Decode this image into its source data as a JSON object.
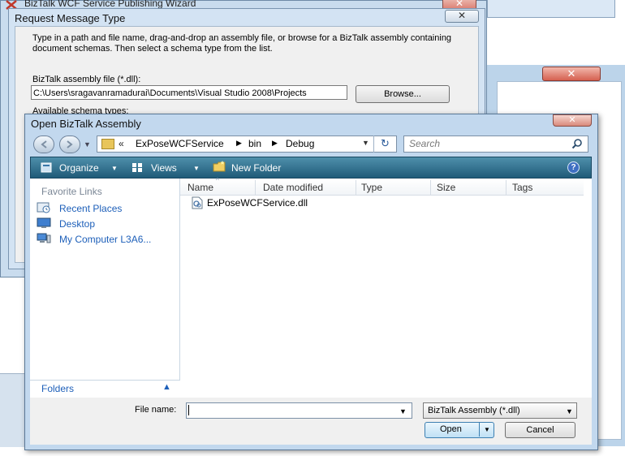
{
  "wizard": {
    "title": "BizTalk WCF Service Publishing Wizard",
    "close_glyph": "✕"
  },
  "background_window": {
    "close_glyph": "✕"
  },
  "request_dialog": {
    "title": "Request Message Type",
    "close_glyph": "✕",
    "description": "Type in a path and file name, drag-and-drop an assembly file, or browse for a BizTalk assembly containing document schemas. Then select a schema type from the list.",
    "assembly_label": "BizTalk assembly file (*.dll):",
    "assembly_path": "C:\\Users\\sragavanramadurai\\Documents\\Visual Studio 2008\\Projects",
    "browse_label": "Browse...",
    "schema_types_label": "Available schema types:"
  },
  "open_dialog": {
    "title": "Open BizTalk Assembly",
    "close_glyph": "✕",
    "address": {
      "overflow_glyph": "«",
      "crumbs": [
        "ExPoseWCFService",
        "bin",
        "Debug"
      ],
      "separator_glyph": "▶",
      "dropdown_glyph": "▼",
      "refresh_glyph": "↻"
    },
    "search": {
      "placeholder": "Search"
    },
    "toolbar": {
      "organize": "Organize",
      "views": "Views",
      "new_folder": "New Folder",
      "dropdown_glyph": "▼",
      "help_glyph": "?"
    },
    "nav": {
      "favorite_links_header": "Favorite Links",
      "items": [
        {
          "label": "Recent Places",
          "icon": "recent-places-icon"
        },
        {
          "label": "Desktop",
          "icon": "desktop-icon"
        },
        {
          "label": "My Computer L3A6...",
          "icon": "computer-icon"
        }
      ],
      "folders_label": "Folders",
      "folders_chevron": "▲"
    },
    "columns": [
      "Name",
      "Date modified",
      "Type",
      "Size",
      "Tags"
    ],
    "sort_glyph": "^",
    "files": [
      {
        "name": "ExPoseWCFService.dll",
        "icon": "dll-file-icon"
      }
    ],
    "file_name_label": "File name:",
    "file_name_value": "",
    "filter_value": "BizTalk Assembly (*.dll)",
    "open_button": "Open",
    "cancel_button": "Cancel"
  },
  "colors": {
    "toolbar_top": "#4f8fab",
    "toolbar_bottom": "#1f5b78",
    "link_blue": "#1d5fb9",
    "frame_blue": "#c2d8ee"
  }
}
